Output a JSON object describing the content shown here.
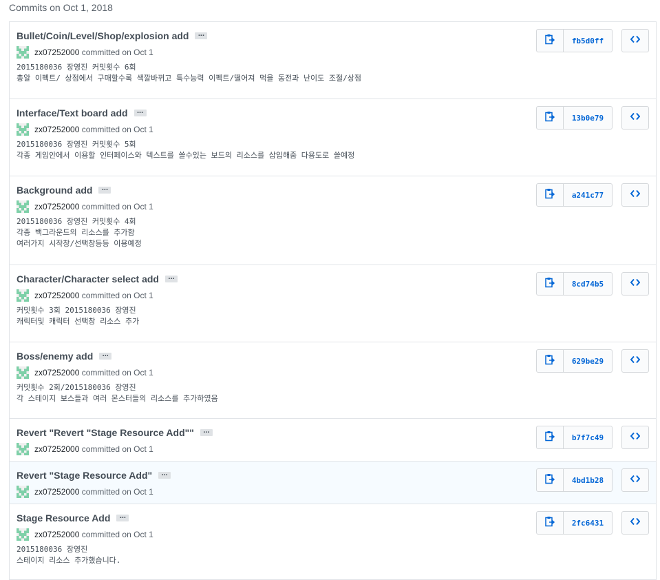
{
  "day_header": "Commits on Oct 1, 2018",
  "colors": {
    "link": "#0366d6",
    "avatar": "#7ed0a8",
    "highlight": "#f6fbff"
  },
  "icons": {
    "copy": "clippy-icon",
    "browse": "code-icon",
    "expand": "ellipsis-icon"
  },
  "ellipsis_label": "...",
  "commits": [
    {
      "title": "Bullet/Coin/Level/Shop/explosion add",
      "author": "zx07252000",
      "action": "committed on",
      "date": "Oct 1",
      "sha": "fb5d0ff",
      "description": "2015180036 장영진 커밋횟수 6회\n총알 이펙트/ 상점에서 구매할수록 색깔바뀌고 특수능력 이펙트/떨어져 먹을 동전과 난이도 조절/상점"
    },
    {
      "title": "Interface/Text board add",
      "author": "zx07252000",
      "action": "committed on",
      "date": "Oct 1",
      "sha": "13b0e79",
      "description": "2015180036 장영진 커밋횟수 5회\n각종 게임안에서 이용할 인터페이스와 텍스트를 쓸수있는 보드의 리소스를 삽입해줌 다용도로 쓸예정"
    },
    {
      "title": "Background add",
      "author": "zx07252000",
      "action": "committed on",
      "date": "Oct 1",
      "sha": "a241c77",
      "description": "2015180036 장영진 커밋횟수 4회\n각종 백그라운드의 리소스를 추가함\n여러가지 시작창/선택창등등 이용예정"
    },
    {
      "title": "Character/Character select add",
      "author": "zx07252000",
      "action": "committed on",
      "date": "Oct 1",
      "sha": "8cd74b5",
      "description": "커밋횟수 3회 2015180036 장영진\n캐릭터및 캐릭터 선택창 리소스 추가"
    },
    {
      "title": "Boss/enemy add",
      "author": "zx07252000",
      "action": "committed on",
      "date": "Oct 1",
      "sha": "629be29",
      "description": "커밋횟수 2회/2015180036 장영진\n각 스테이지 보스들과 여러 몬스터들의 리소스를 추가하였음"
    },
    {
      "title": "Revert \"Revert \"Stage Resource Add\"\"",
      "author": "zx07252000",
      "action": "committed on",
      "date": "Oct 1",
      "sha": "b7f7c49",
      "description": ""
    },
    {
      "title": "Revert \"Stage Resource Add\"",
      "author": "zx07252000",
      "action": "committed on",
      "date": "Oct 1",
      "sha": "4bd1b28",
      "description": ""
    },
    {
      "title": "Stage Resource Add",
      "author": "zx07252000",
      "action": "committed on",
      "date": "Oct 1",
      "sha": "2fc6431",
      "description": "2015180036 장영진\n스테이지 리소스 추가했습니다."
    }
  ]
}
